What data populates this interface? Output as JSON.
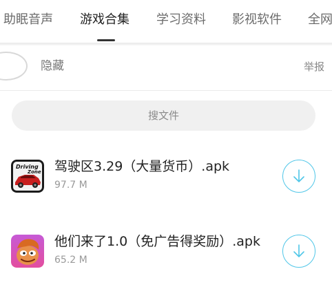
{
  "tabs": [
    {
      "label": "助眠音声"
    },
    {
      "label": "游戏合集"
    },
    {
      "label": "学习资料"
    },
    {
      "label": "影视软件"
    },
    {
      "label": "全网"
    }
  ],
  "hidden_row": {
    "label": "隐藏",
    "report": "举报"
  },
  "search": {
    "label": "搜文件"
  },
  "files": [
    {
      "name": "驾驶区3.29（大量货币）.apk",
      "size": "97.7 M",
      "icon_text_1": "Driving",
      "icon_text_2": "Zone"
    },
    {
      "name": "他们来了1.0（免广告得奖励）.apk",
      "size": "65.2 M"
    }
  ],
  "colors": {
    "accent": "#4fc6e8",
    "active_tab": "#222222",
    "inactive_tab": "#6b6b6b"
  }
}
